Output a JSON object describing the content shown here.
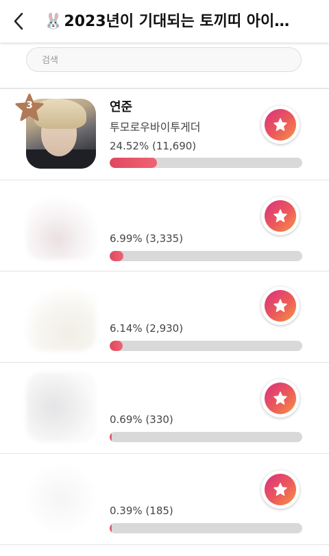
{
  "header": {
    "back_icon": "chevron-left-icon",
    "title_emoji": "🐰",
    "title": "2023년이 기대되는 토끼띠 아이…"
  },
  "search": {
    "placeholder": "검색",
    "value": ""
  },
  "colors": {
    "bar_fill": "#e0475e",
    "bar_track": "#d9d9d9",
    "vote_gradient_start": "#d9307f",
    "vote_gradient_end": "#f59645",
    "rank_badge": "#b07a57"
  },
  "rows": [
    {
      "rank": "3",
      "name": "연준",
      "group": "투모로우바이투게더",
      "stat": "24.52% (11,690)",
      "fill_percent": 24.52,
      "avatar": "photo",
      "vote_icon": "star-icon"
    },
    {
      "rank": "",
      "name": "",
      "group": "",
      "stat": "6.99% (3,335)",
      "fill_percent": 6.99,
      "avatar": "blurred",
      "vote_icon": "star-icon"
    },
    {
      "rank": "",
      "name": "",
      "group": "",
      "stat": "6.14% (2,930)",
      "fill_percent": 6.14,
      "avatar": "blurred",
      "vote_icon": "star-icon"
    },
    {
      "rank": "",
      "name": "",
      "group": "",
      "stat": "0.69% (330)",
      "fill_percent": 0.69,
      "avatar": "blurred",
      "vote_icon": "star-icon"
    },
    {
      "rank": "",
      "name": "",
      "group": "",
      "stat": "0.39% (185)",
      "fill_percent": 0.39,
      "avatar": "blurred",
      "vote_icon": "star-icon"
    }
  ]
}
